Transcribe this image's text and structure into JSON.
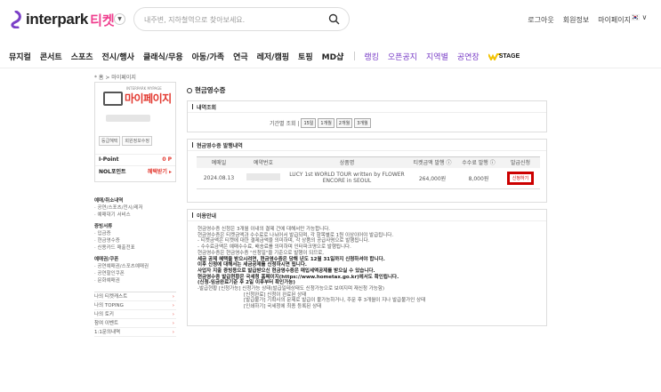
{
  "header": {
    "brand": "interpark",
    "brand_ticket": "티켓",
    "search_placeholder": "내주변, 지하철역으로 찾아보세요.",
    "links": [
      "로그아웃",
      "회원정보",
      "마이페이지"
    ],
    "lang": "🇰🇷 ∨"
  },
  "nav": {
    "items": [
      "뮤지컬",
      "콘서트",
      "스포츠",
      "전시/행사",
      "클래식/무용",
      "아동/가족",
      "연극",
      "레저/캠핑",
      "토핑",
      "MD샵"
    ],
    "specials": [
      "랭킹",
      "오픈공지",
      "지역별",
      "공연장"
    ],
    "stage": "STAGE"
  },
  "breadcrumb": "* 홈 > 마이페이지",
  "sidebar": {
    "mypage_small": "INTERPARK MYPAGE",
    "mypage": "마이페이지",
    "grade": "등급혜택",
    "grade2": "회원정보수정",
    "ipoint_label": "I-Point",
    "ipoint_value": "0 P",
    "nol_label": "NOL포인트",
    "nol_value": "혜택받기 ▸",
    "menu": [
      {
        "h": "예매/취소내역"
      },
      {
        "t": "· 공연/스포츠/전시/레저"
      },
      {
        "t": "· 예매대기 서비스"
      },
      {
        "h": "증빙서류"
      },
      {
        "t": "· 입금증"
      },
      {
        "t": "· 현금영수증"
      },
      {
        "t": "· 신용카드 매출전표"
      },
      {
        "h": "예매권/쿠폰"
      },
      {
        "t": "· 공연예매권/스포츠예매권"
      },
      {
        "t": "· 공연할인쿠폰"
      },
      {
        "t": "· 문화예매권"
      }
    ],
    "list": [
      "나의 티켓캐스트",
      "나의 TOPING",
      "나의 토키",
      "참여 이벤트",
      "1:1문의내역"
    ]
  },
  "main": {
    "title": "현금영수증",
    "search_title": "내역조회",
    "period_label": "기간별 조회 |",
    "period_buttons": [
      "15일",
      "1개월",
      "2개월",
      "3개월"
    ],
    "issue_title": "현금영수증 발행내역",
    "columns": [
      "예매일",
      "예약번호",
      "상품명",
      "티켓금액 발행 ⓘ",
      "수수료 발행 ⓘ",
      "발급신청"
    ],
    "rows": [
      {
        "date": "2024.08.13",
        "no": "",
        "product": "LUCY 1st WORLD TOUR written by FLOWER ENCORE in SEOUL",
        "ticket": "264,000원",
        "fee": "8,000원",
        "btn": "신청하기"
      }
    ],
    "guide_title": "이용안내",
    "guide": [
      {
        "t": "현금영수증 신청은 3개월 이내의 결제 건에 대해서만 가능합니다.",
        "b": false,
        "i": false
      },
      {
        "t": "현금영수증은 티켓금액과 수수료로 나뉘어서 발급되며, 각 항목별로 1원 이상이어야 발급됩니다.",
        "b": false,
        "i": false
      },
      {
        "t": "- 티켓금액은 티켓에 대한 결제금액을 의미하며, 각 상품의 공급사명으로 발행됩니다.",
        "b": false,
        "i": false
      },
      {
        "t": "- 수수료금액은 예매수수료, 배송료를 의미하며 인터파크명으로 발행됩니다.",
        "b": false,
        "i": false
      },
      {
        "t": "현금영수증은 현금영수증 \"신청일\"을 기준으로 발행이 되므로,",
        "b": false,
        "i": false
      },
      {
        "t": "세금 공제 혜택을 받으시려면, 현금영수증은 당해 년도 12월 31일까지 신청하셔야 합니다.",
        "b": true,
        "i": false
      },
      {
        "t": "이후 신청에 대해서는 세금공제를 신청하시면 됩니다.",
        "b": true,
        "i": false
      },
      {
        "t": "사업자 지출 증빙용으로 발급받으신 현금영수증은 매입세액공제를 받으실 수 있습니다.",
        "b": true,
        "i": false
      },
      {
        "t": "현금영수증 발급현황은 국세청 홈페이지(https://www.hometax.go.kr)에서도 확인됩니다.",
        "b": true,
        "i": false
      },
      {
        "t": "(신청-임금완료기준 후 2일 이후부터 확인가능)",
        "b": true,
        "i": false
      },
      {
        "t": "-발급현황      [신청가능] 신청가능 상태(발급일테상태도 신청가능으로 보여지며 재신청 가능함)",
        "b": false,
        "i": false
      },
      {
        "t": "[신청완료] 신청이 완료된 상태",
        "b": false,
        "i": true
      },
      {
        "t": "[발급불가] 기확사의 문제로 발급이 불가능하거나, 주문 후 3개월이 지나 발급불가인 상태",
        "b": false,
        "i": true
      },
      {
        "t": "[인쇄하기] 국세청에 최종 등록된 상태",
        "b": false,
        "i": true
      }
    ]
  }
}
